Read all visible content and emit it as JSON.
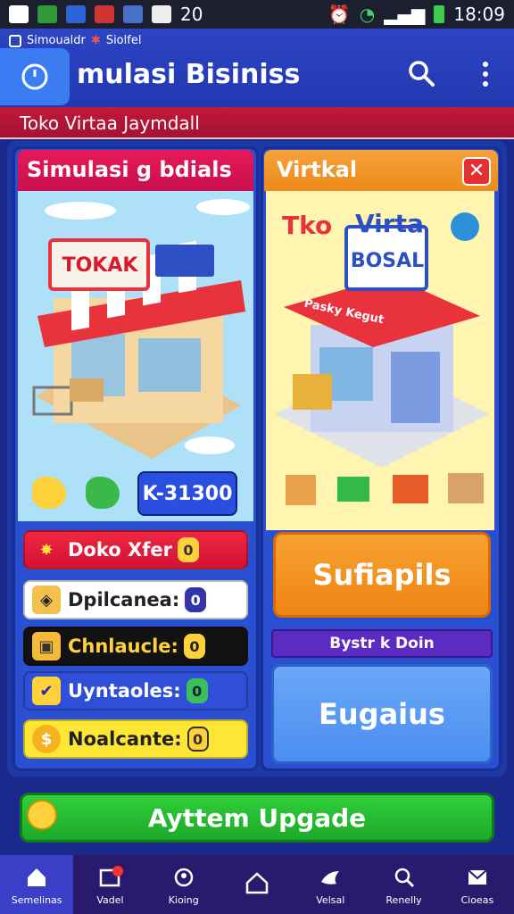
{
  "status_bar": {
    "time": "18:09",
    "extra": "20"
  },
  "app_bar": {
    "subtitle": "Simoualdr",
    "subtitle2": "Siolfel",
    "title": "mulasi Bisiniss"
  },
  "banner": {
    "text": "Toko Virtaa Jaymdall"
  },
  "left_panel": {
    "title": "Simulasi g bdials",
    "scene_sign": "TOKAK",
    "counter": "K-31300",
    "stats": [
      {
        "label": "Doko Xfer",
        "badge": "0"
      },
      {
        "label": "Dpilcanea:",
        "badge": "0"
      },
      {
        "label": "Chnlaucle:",
        "badge": "0"
      },
      {
        "label": "Uyntaoles:",
        "badge": "0"
      },
      {
        "label": "Noalcante:",
        "badge": "0"
      }
    ]
  },
  "right_panel": {
    "title": "Virtkal",
    "scene_word1": "Tko",
    "scene_word2": "Virta",
    "store_sign": "BOSAL",
    "awning_text": "Pasky Kegut",
    "orange_button": "Sufiapils",
    "purple_label": "Bystr k Doin",
    "blue_button": "Eugaius"
  },
  "upgrade_button": "Ayttem Upgade",
  "bottom_nav": [
    {
      "label": "Semelinas"
    },
    {
      "label": "Vadel"
    },
    {
      "label": "Kioing"
    },
    {
      "label": ""
    },
    {
      "label": "Velsal"
    },
    {
      "label": "Renelly"
    },
    {
      "label": "Cioeas"
    }
  ],
  "colors": {
    "primary": "#2238b0",
    "banner": "#c2183a",
    "accent_orange": "#f8a232",
    "accent_green": "#2fcf3a"
  }
}
